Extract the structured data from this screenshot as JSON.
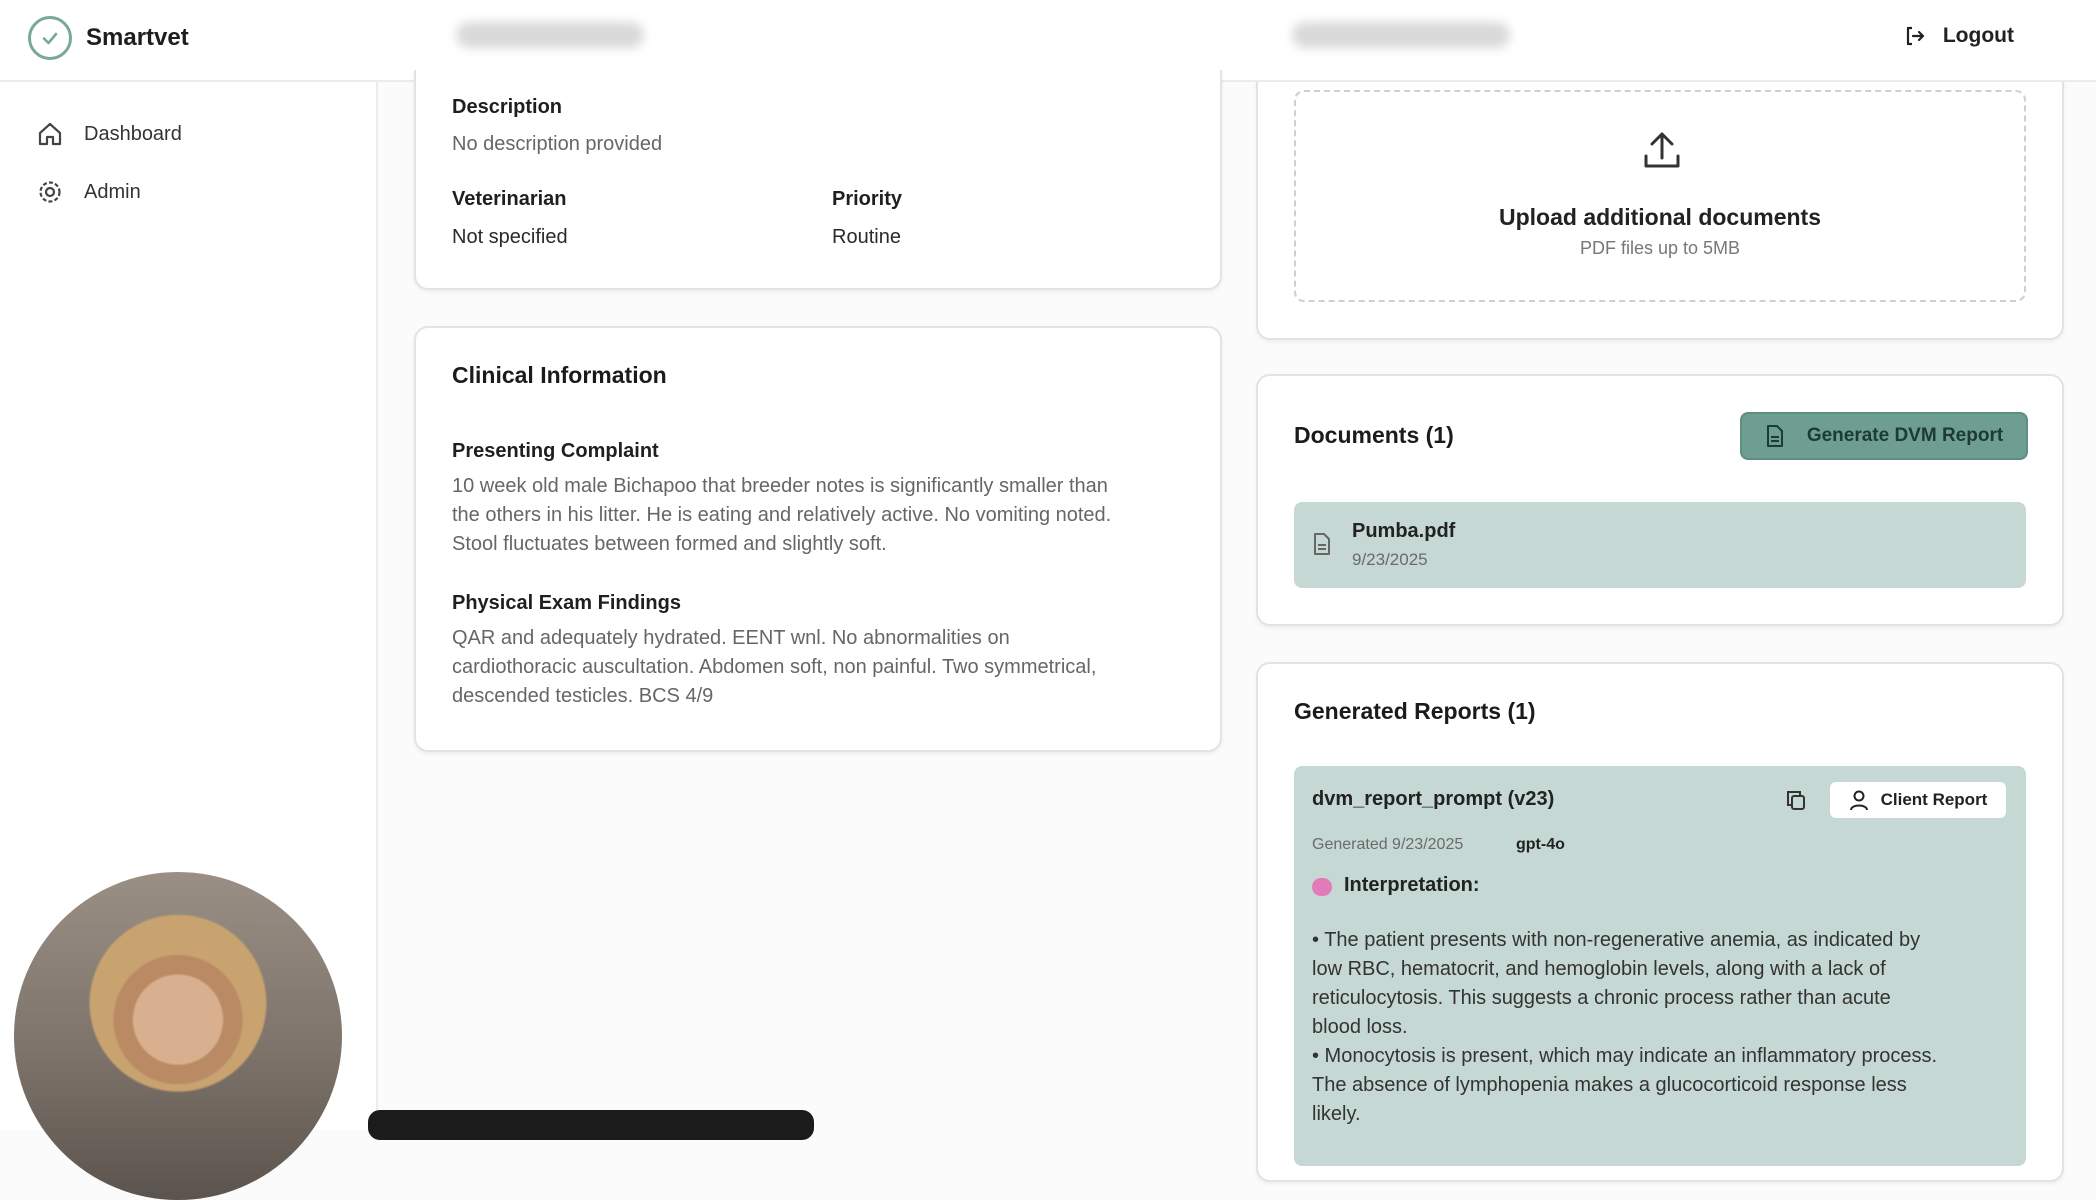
{
  "app": {
    "name": "Smartvet"
  },
  "header": {
    "logout_label": "Logout"
  },
  "sidebar": {
    "items": [
      {
        "label": "Dashboard"
      },
      {
        "label": "Admin"
      }
    ]
  },
  "case": {
    "description_label": "Description",
    "description_value": "No description provided",
    "veterinarian_label": "Veterinarian",
    "veterinarian_value": "Not specified",
    "priority_label": "Priority",
    "priority_value": "Routine"
  },
  "clinical": {
    "title": "Clinical Information",
    "complaint_label": "Presenting Complaint",
    "complaint_lines": [
      "10 week old male Bichapoo that breeder notes is significantly smaller than",
      "the others in his litter. He is eating and relatively active. No vomiting noted.",
      "Stool fluctuates between formed and slightly soft."
    ],
    "exam_label": "Physical Exam Findings",
    "exam_lines": [
      "QAR and adequately hydrated. EENT wnl. No abnormalities on",
      "cardiothoracic auscultation. Abdomen soft, non painful. Two symmetrical,",
      "descended testicles. BCS 4/9"
    ]
  },
  "upload": {
    "title": "Upload additional documents",
    "subtitle": "PDF files up to 5MB"
  },
  "documents": {
    "title": "Documents (1)",
    "generate_label": "Generate DVM Report",
    "items": [
      {
        "name": "Pumba.pdf",
        "date": "9/23/2025"
      }
    ]
  },
  "reports": {
    "title": "Generated Reports (1)",
    "items": [
      {
        "name": "dvm_report_prompt (v23)",
        "client_report_label": "Client Report",
        "generated": "Generated 9/23/2025",
        "model": "gpt-4o",
        "interpretation_label": "Interpretation:",
        "lines": [
          "• The patient presents with non-regenerative anemia, as indicated by",
          "low RBC, hematocrit, and hemoglobin levels, along with a lack of",
          "reticulocytosis. This suggests a chronic process rather than acute",
          "blood loss.",
          "• Monocytosis is present, which may indicate an inflammatory process.",
          "The absence of lymphopenia makes a glucocorticoid response less",
          "likely."
        ]
      }
    ]
  },
  "colors": {
    "accent": "#6e9d92",
    "panel": "#c6d8d3"
  }
}
